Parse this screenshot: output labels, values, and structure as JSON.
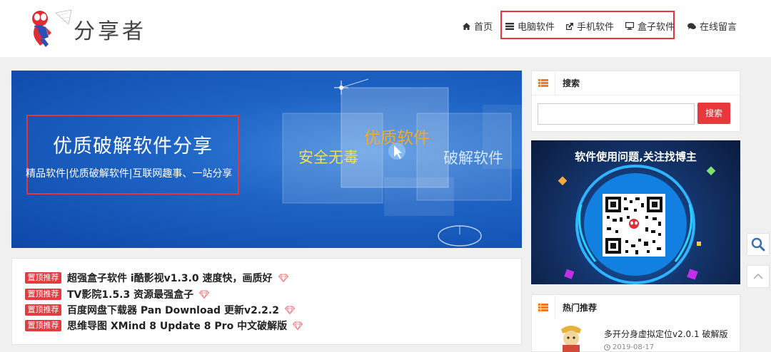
{
  "site": {
    "name": "分享者"
  },
  "nav": [
    {
      "label": "首页",
      "icon": "home-icon"
    },
    {
      "label": "电脑软件",
      "icon": "list-icon"
    },
    {
      "label": "手机软件",
      "icon": "share-icon"
    },
    {
      "label": "盒子软件",
      "icon": "monitor-icon"
    },
    {
      "label": "在线留言",
      "icon": "comments-icon"
    }
  ],
  "banner": {
    "title": "优质破解软件分享",
    "subtitle": "精品软件|优质破解软件|互联网趣事、一站分享",
    "tag_safe": "安全无毒",
    "tag_quality": "优质软件",
    "tag_crack": "破解软件"
  },
  "recommend": {
    "badge": "置顶推荐",
    "items": [
      "超强盒子软件 i酷影视v1.3.0 速度快，画质好",
      "TV影院1.5.3 资源最强盒子",
      "百度网盘下载器 Pan Download 更新v2.2.2",
      "思维导图 XMind 8 Update 8 Pro 中文破解版"
    ]
  },
  "sidebar": {
    "search_title": "搜索",
    "search_button": "搜索",
    "search_placeholder": "",
    "promo_title": "软件使用问题,关注找博主",
    "hot_title": "热门推荐",
    "hot_items": [
      {
        "title": "多开分身虚拟定位v2.0.1 破解版",
        "date": "2019-08-17"
      }
    ]
  },
  "colors": {
    "accent": "#e8383c",
    "banner": "#1e64c5"
  }
}
